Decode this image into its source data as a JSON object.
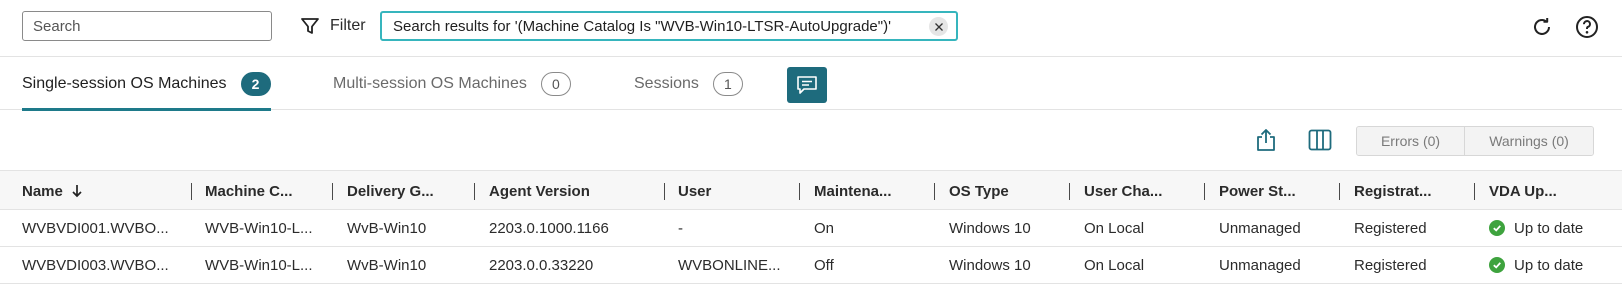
{
  "search": {
    "placeholder": "Search"
  },
  "filter": {
    "label": "Filter",
    "chip_text": "Search results for '(Machine Catalog Is \"WVB-Win10-LTSR-AutoUpgrade\")'"
  },
  "tabs": [
    {
      "label": "Single-session OS Machines",
      "count": "2",
      "active": true
    },
    {
      "label": "Multi-session OS Machines",
      "count": "0",
      "active": false
    },
    {
      "label": "Sessions",
      "count": "1",
      "active": false
    }
  ],
  "toolbar": {
    "errors_label": "Errors (0)",
    "warnings_label": "Warnings (0)"
  },
  "table": {
    "columns": [
      "Name",
      "Machine C...",
      "Delivery G...",
      "Agent Version",
      "User",
      "Maintena...",
      "OS Type",
      "User Cha...",
      "Power St...",
      "Registrat...",
      "VDA Up..."
    ],
    "rows": [
      [
        "WVBVDI001.WVBO...",
        "WVB-Win10-L...",
        "WvB-Win10",
        "2203.0.1000.1166",
        "-",
        "On",
        "Windows 10",
        "On Local",
        "Unmanaged",
        "Registered",
        "Up to date"
      ],
      [
        "WVBVDI003.WVBO...",
        "WVB-Win10-L...",
        "WvB-Win10",
        "2203.0.0.33220",
        "WVBONLINE...",
        "Off",
        "Windows 10",
        "On Local",
        "Unmanaged",
        "Registered",
        "Up to date"
      ]
    ]
  },
  "icons": {
    "filter": "funnel-icon",
    "clear": "close-icon",
    "refresh": "refresh-icon",
    "help": "help-icon",
    "feedback": "chat-icon",
    "export": "export-icon",
    "columns": "columns-icon",
    "sort": "arrow-down-icon",
    "status_ok": "check-circle-icon"
  },
  "colors": {
    "accent": "#1e6b7d",
    "chip_border": "#36b5bd",
    "ok_green": "#3ea33e"
  }
}
